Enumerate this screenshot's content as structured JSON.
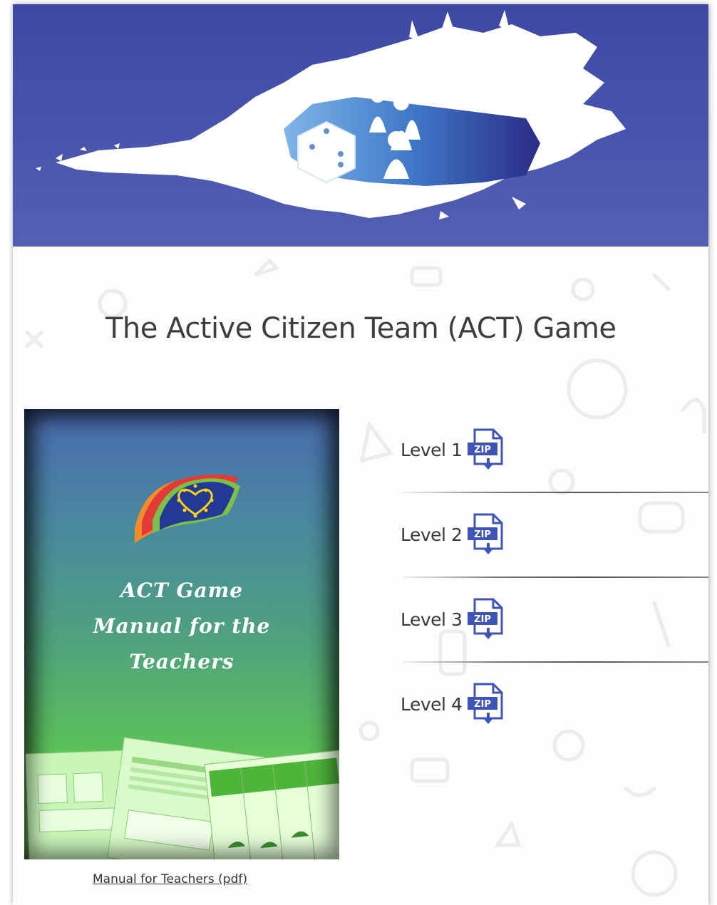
{
  "page": {
    "title": "The Active Citizen Team (ACT) Game"
  },
  "banner": {
    "icon": "board-game-splash-image"
  },
  "manual": {
    "cover_title_line1": "ACT Game",
    "cover_title_line2": "Manual for the",
    "cover_title_line3": "Teachers",
    "link_label": "Manual for Teachers (pdf)"
  },
  "levels": [
    {
      "label": "Level 1",
      "icon": "zip-download-icon",
      "icon_text": "ZIP"
    },
    {
      "label": "Level 2",
      "icon": "zip-download-icon",
      "icon_text": "ZIP"
    },
    {
      "label": "Level 3",
      "icon": "zip-download-icon",
      "icon_text": "ZIP"
    },
    {
      "label": "Level 4",
      "icon": "zip-download-icon",
      "icon_text": "ZIP"
    }
  ],
  "colors": {
    "banner": "#4551a9",
    "zip_icon": "#3f55b5",
    "cover_top": "#4a6bb1",
    "cover_bottom": "#8fe77a"
  }
}
